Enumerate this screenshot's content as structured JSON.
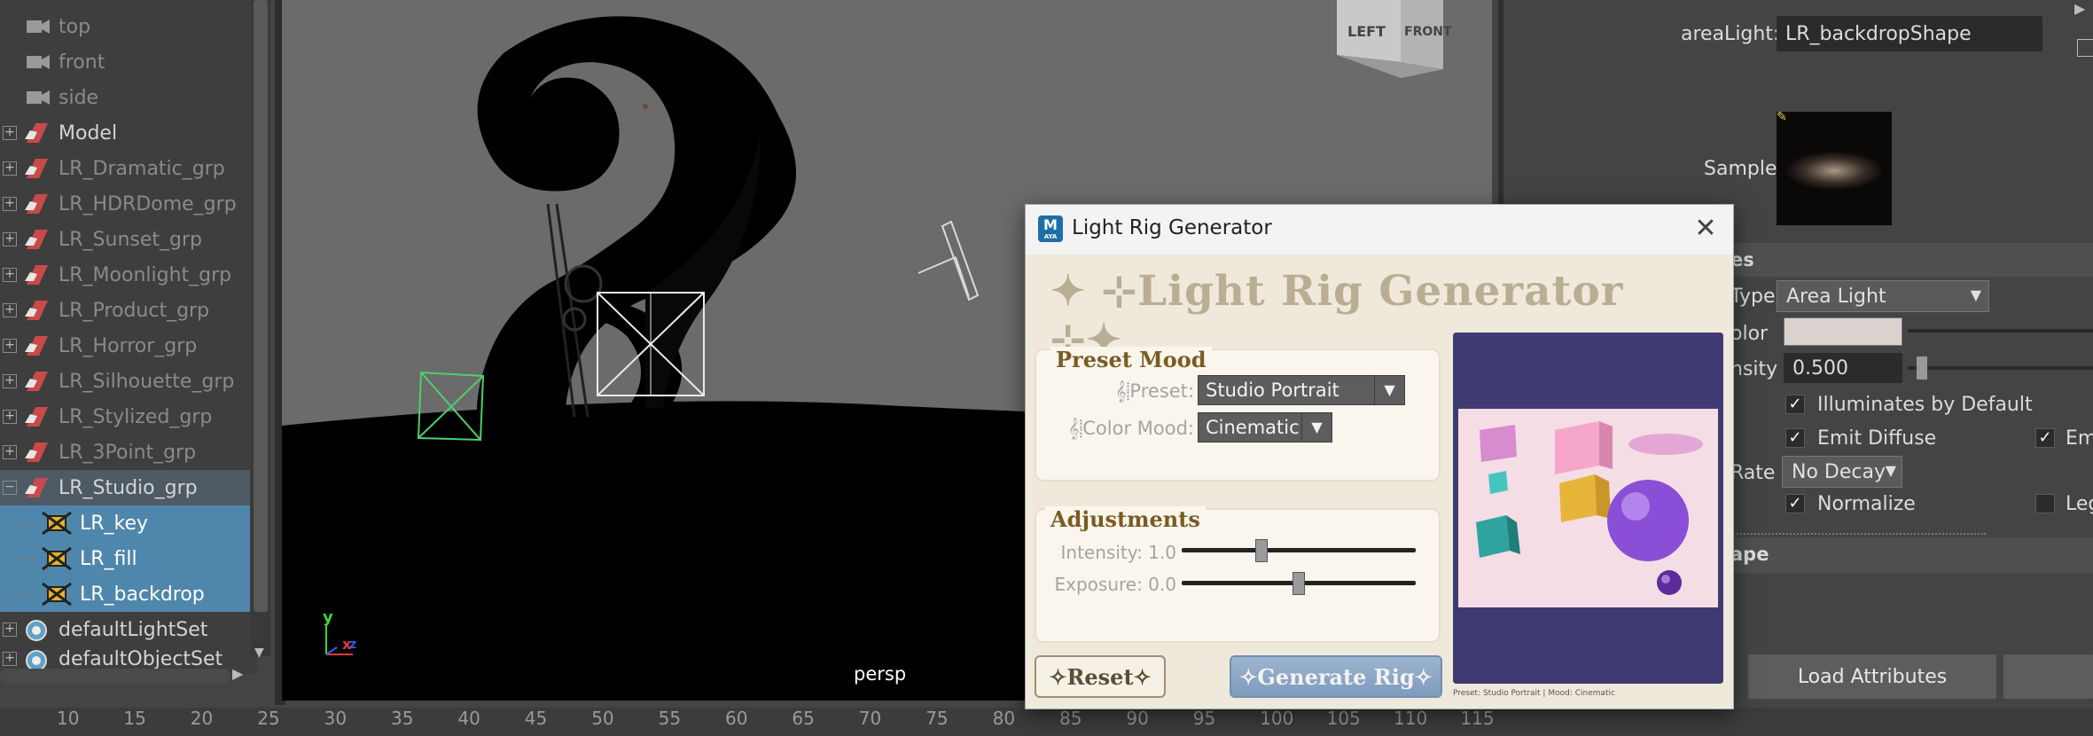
{
  "outliner": {
    "cameras": [
      {
        "label": "top",
        "icon": "camera-icon"
      },
      {
        "label": "front",
        "icon": "camera-icon"
      },
      {
        "label": "side",
        "icon": "camera-icon"
      }
    ],
    "groups": [
      {
        "label": "Model",
        "dim": false
      },
      {
        "label": "LR_Dramatic_grp",
        "dim": true
      },
      {
        "label": "LR_HDRDome_grp",
        "dim": true
      },
      {
        "label": "LR_Sunset_grp",
        "dim": true
      },
      {
        "label": "LR_Moonlight_grp",
        "dim": true
      },
      {
        "label": "LR_Product_grp",
        "dim": true
      },
      {
        "label": "LR_Horror_grp",
        "dim": true
      },
      {
        "label": "LR_Silhouette_grp",
        "dim": true
      },
      {
        "label": "LR_Stylized_grp",
        "dim": true
      },
      {
        "label": "LR_3Point_grp",
        "dim": true
      }
    ],
    "studio_group": "LR_Studio_grp",
    "studio_children": [
      "LR_key",
      "LR_fill",
      "LR_backdrop"
    ],
    "sets": [
      "defaultLightSet",
      "defaultObjectSet"
    ]
  },
  "viewport": {
    "camera_label": "persp",
    "cube_left": "LEFT",
    "cube_front": "FRONT",
    "axis_y": "y",
    "axis_x": "x",
    "axis_z": "z"
  },
  "timeline": {
    "ticks": [
      "10",
      "15",
      "20",
      "25",
      "30",
      "35",
      "40",
      "45",
      "50",
      "55",
      "60",
      "65",
      "70",
      "75",
      "80",
      "85",
      "90",
      "95",
      "100",
      "105",
      "110",
      "115"
    ]
  },
  "attribute_editor": {
    "area_light_label": "areaLight:",
    "area_light_value": "LR_backdropShape",
    "sample_label": "Sample",
    "section_attributes": "es",
    "type_label": "Type",
    "type_value": "Area Light",
    "color_label": "olor",
    "intensity_label": "nsity",
    "intensity_value": "0.500",
    "illuminates_label": "Illuminates by Default",
    "emit_diffuse_label": "Emit Diffuse",
    "emit_specular_label": "Em",
    "decay_label": "Rate",
    "decay_value": "No Decay",
    "normalize_label": "Normalize",
    "legacy_label": "Leg",
    "section_shape": "ape",
    "load_attributes": "Load Attributes",
    "colors": {
      "light_color": "#d9d2cf"
    }
  },
  "dialog": {
    "window_title": "Light Rig Generator",
    "app_badge": "M",
    "app_badge_sub": "AYA",
    "header": "✦ ⊹Light Rig Generator ⊹✦",
    "preset_mood_title": "Preset Mood",
    "preset_label": "𝄞⸽Preset:",
    "preset_value": "Studio Portrait",
    "color_mood_label": "𝄞⸽Color Mood:",
    "color_mood_value": "Cinematic",
    "adjustments_title": "Adjustments",
    "intensity_label": "Intensity: 1.0",
    "intensity_fraction": 0.34,
    "exposure_label": "Exposure: 0.0",
    "exposure_fraction": 0.5,
    "reset_label": "✧Reset✧",
    "generate_label": "✧Generate Rig✧",
    "caption": "Preset: Studio Portrait | Mood: Cinematic",
    "colors": {
      "accent": "#7a5c22",
      "header": "#b9ad94"
    }
  }
}
